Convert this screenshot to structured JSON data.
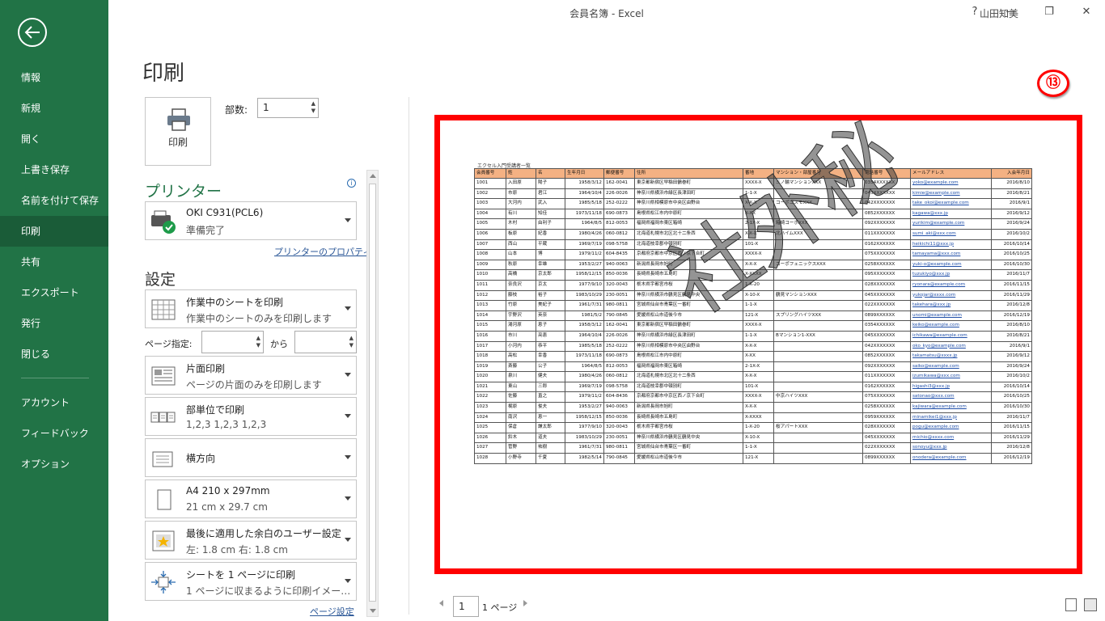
{
  "titlebar": {
    "title": "会員名簿  -  Excel",
    "user": "山田知美",
    "help": "?",
    "minimize": "—",
    "restore": "❐",
    "close": "✕"
  },
  "nav": {
    "items": [
      "情報",
      "新規",
      "開く",
      "上書き保存",
      "名前を付けて保存",
      "印刷",
      "共有",
      "エクスポート",
      "発行",
      "閉じる"
    ],
    "lower_items": [
      "アカウント",
      "フィードバック",
      "オプション"
    ],
    "active": "印刷"
  },
  "print": {
    "title": "印刷",
    "button_label": "印刷",
    "copies_label": "部数:",
    "copies_value": "1"
  },
  "printer": {
    "heading": "プリンター",
    "name": "OKI C931(PCL6)",
    "status": "準備完了",
    "properties_link": "プリンターのプロパティ"
  },
  "settings": {
    "heading": "設定",
    "sheet_scope": {
      "title": "作業中のシートを印刷",
      "desc": "作業中のシートのみを印刷します"
    },
    "page_range_label": "ページ指定:",
    "page_range_to": "から",
    "sides": {
      "title": "片面印刷",
      "desc": "ページの片面のみを印刷します"
    },
    "collate": {
      "title": "部単位で印刷",
      "desc": "1,2,3    1,2,3    1,2,3"
    },
    "orientation": {
      "title": "横方向"
    },
    "paper": {
      "title": "A4 210 x 297mm",
      "desc": "21 cm x 29.7 cm"
    },
    "margins": {
      "title": "最後に適用した余白のユーザー設定",
      "desc": "左:  1.8 cm    右:  1.8 cm"
    },
    "scaling": {
      "title": "シートを 1 ページに印刷",
      "desc": "1 ページに収まるように印刷イメー…"
    },
    "page_setup_link": "ページ設定"
  },
  "preview": {
    "step_badge": "⑬",
    "caption": "エクセル入門受講者一覧",
    "watermark": "社外秘",
    "page_current": "1",
    "page_total": "1 ページ",
    "columns": [
      "会員番号",
      "姓",
      "名",
      "生年月日",
      "郵便番号",
      "住所",
      "番地",
      "マンション・部屋番号",
      "電話番号",
      "メールアドレス",
      "入会年月日"
    ],
    "rows": [
      [
        "1001",
        "入田原",
        "陽子",
        "1958/3/12",
        "162-0041",
        "東京都新宿区早稲田鶴巻町",
        "XXXX-X",
        "三ノ輪マンションXXX",
        "0354XXXXXX",
        "yoko@example.com",
        "2016/8/10"
      ],
      [
        "1002",
        "市原",
        "君江",
        "1964/10/4",
        "226-0026",
        "神奈川県横浜市緑区長津田町",
        "1-1-X",
        "",
        "045XXXXXXX",
        "kimie@example.com",
        "2016/8/21"
      ],
      [
        "1003",
        "大河内",
        "武入",
        "1985/5/18",
        "252-0222",
        "神奈川県相模原市中央区由野台",
        "X-X-X",
        "コーポコスモXXX",
        "042XXXXXXX",
        "take_okoi@example.com",
        "2016/9/1"
      ],
      [
        "1004",
        "有川",
        "知佳",
        "1973/11/18",
        "690-0873",
        "島根県松江市内中原町",
        "X-XX",
        "",
        "0852XXXXXX",
        "kagawa@xxx.jp",
        "2016/9/12"
      ],
      [
        "1005",
        "木村",
        "由利子",
        "1964/8/5",
        "812-0053",
        "福岡県福岡市東区箱崎",
        "2-1X-X",
        "箱崎コーポXXX",
        "092XXXXXXX",
        "yurikim@example.com",
        "2016/9/24"
      ],
      [
        "1006",
        "板原",
        "紀香",
        "1980/4/26",
        "060-0812",
        "北海道札幌市北区北十二条西",
        "X-X-X",
        "北ハイムXXX",
        "011XXXXXXX",
        "sumi_aki@xxx.com",
        "2016/10/2"
      ],
      [
        "1007",
        "西山",
        "平蔵",
        "1969/7/19",
        "098-5758",
        "北海道枝幸郡中頓別町",
        "101-X",
        "",
        "0162XXXXXX",
        "heikichi11@xxx.jp",
        "2016/10/14"
      ],
      [
        "1008",
        "山本",
        "博",
        "1979/11/2",
        "604-8435",
        "京都府京都市中京区西ノ京下合町",
        "XXXX-X",
        "",
        "075XXXXXXX",
        "tamayama@xxx.com",
        "2016/10/25"
      ],
      [
        "1009",
        "秋原",
        "幸雄",
        "1953/2/27",
        "940-0063",
        "新潟県長岡市旭町",
        "X-X-X",
        "コーポフェニックスXXX",
        "0258XXXXXX",
        "yuki-o@example.com",
        "2016/10/30"
      ],
      [
        "1010",
        "高橋",
        "京太郎",
        "1958/12/15",
        "850-0036",
        "長崎県長崎市五島町",
        "X-XXXX",
        "",
        "095XXXXXXX",
        "tuzukiyo@xxx.jp",
        "2016/11/7"
      ],
      [
        "1011",
        "奈良沢",
        "京太",
        "1977/9/10",
        "320-0043",
        "栃木県宇都宮市桜",
        "1-X-20",
        "",
        "028XXXXXXX",
        "ryonara@example.com",
        "2016/11/15"
      ],
      [
        "1012",
        "藤枝",
        "裕子",
        "1983/10/29",
        "230-0051",
        "神奈川県横浜市鶴見区鶴見中央",
        "X-10-X",
        "鶴見マンションXXX",
        "045XXXXXXX",
        "yukojar@xxxx.com",
        "2016/11/29"
      ],
      [
        "1013",
        "竹原",
        "美紀子",
        "1961/7/31",
        "980-0811",
        "宮城県仙台市青葉区一番町",
        "1-1-X",
        "",
        "022XXXXXXX",
        "takehara@xxx.jp",
        "2016/12/8"
      ],
      [
        "1014",
        "宇野沢",
        "英奈",
        "1981/5/2",
        "790-0845",
        "愛媛県松山市道後今市",
        "121-X",
        "スプリングハイツXXX",
        "0899XXXXXX",
        "unomi@example.com",
        "2016/12/19"
      ],
      [
        "1015",
        "湯河原",
        "恵子",
        "1958/3/12",
        "162-0041",
        "東京都新宿区早稲田鶴巻町",
        "XXXX-X",
        "",
        "0354XXXXXX",
        "keiko@example.com",
        "2016/8/10"
      ],
      [
        "1016",
        "市川",
        "亮恵",
        "1964/10/4",
        "226-0026",
        "神奈川県横浜市緑区長津田町",
        "1-1-X",
        "Bマンション1-XXX",
        "045XXXXXXX",
        "ichikawa@example.com",
        "2016/8/21"
      ],
      [
        "1017",
        "小河内",
        "恭平",
        "1985/5/18",
        "252-0222",
        "神奈川県相模原市中央区由野台",
        "X-X-X",
        "",
        "042XXXXXXX",
        "oko_kyo@example.com",
        "2016/9/1"
      ],
      [
        "1018",
        "高松",
        "幸香",
        "1973/11/18",
        "690-0873",
        "島根県松江市内中原町",
        "X-XX",
        "",
        "0852XXXXXX",
        "takamatsu@xxxx.jp",
        "2016/9/12"
      ],
      [
        "1019",
        "斎藤",
        "公子",
        "1964/8/5",
        "812-0053",
        "福岡県福岡市東区箱崎",
        "2-1X-X",
        "",
        "092XXXXXXX",
        "saiko@example.com",
        "2016/9/24"
      ],
      [
        "1020",
        "泉川",
        "健夫",
        "1980/4/26",
        "060-0812",
        "北海道札幌市北区北十二条西",
        "X-X-X",
        "",
        "011XXXXXXX",
        "izumikawa@xxx.com",
        "2016/10/2"
      ],
      [
        "1021",
        "東山",
        "三郎",
        "1969/7/19",
        "098-5758",
        "北海道枝幸郡中頓別町",
        "101-X",
        "",
        "0162XXXXXX",
        "higashi3@xxx.jp",
        "2016/10/14"
      ],
      [
        "1022",
        "佐藤",
        "直之",
        "1979/11/2",
        "604-8436",
        "京都府京都市中京区西ノ京下合町",
        "XXXX-X",
        "中京ハイツXXX",
        "075XXXXXXX",
        "satonao@xxx.com",
        "2016/10/25"
      ],
      [
        "1023",
        "梶原",
        "俊夫",
        "1953/2/27",
        "940-0063",
        "新潟県長岡市旭町",
        "X-X-X",
        "",
        "0258XXXXXX",
        "kajiwara@example.com",
        "2016/10/30"
      ],
      [
        "1024",
        "南沢",
        "恵一",
        "1958/12/15",
        "850-0036",
        "長崎県長崎市五島町",
        "X-XXXX",
        "",
        "0959XXXXXX",
        "minamikei1@xxx.jp",
        "2016/11/7"
      ],
      [
        "1025",
        "保倉",
        "謙太郎",
        "1977/9/10",
        "320-0043",
        "栃木県宇都宮市桜",
        "1-X-20",
        "桜アパートXXX",
        "028XXXXXXX",
        "pogu@example.com",
        "2016/11/15"
      ],
      [
        "1026",
        "鈴木",
        "道夫",
        "1983/10/29",
        "230-0051",
        "神奈川県横浜市鶴見区鶴見中央",
        "X-10-X",
        "",
        "045XXXXXXX",
        "michio@xxxx.com",
        "2016/11/29"
      ],
      [
        "1027",
        "菅野",
        "祐樹",
        "1961/7/31",
        "980-0811",
        "宮城県仙台市青葉区一番町",
        "1-1-X",
        "",
        "022XXXXXXX",
        "sonoyu@xxx.jp",
        "2016/12/8"
      ],
      [
        "1028",
        "小野寺",
        "千夏",
        "1982/5/14",
        "790-0845",
        "愛媛県松山市道後今市",
        "121-X",
        "",
        "0899XXXXXX",
        "onodera@example.com",
        "2016/12/19"
      ]
    ]
  },
  "colors": {
    "excel_green": "#217346",
    "highlight_red": "#ff0000",
    "header_orange": "#f4b183"
  }
}
